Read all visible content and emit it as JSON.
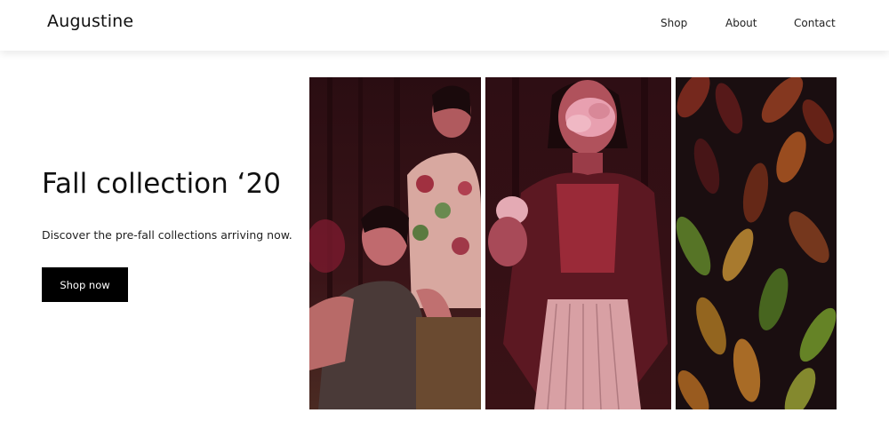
{
  "header": {
    "brand": "Augustine",
    "nav": [
      "Shop",
      "About",
      "Contact"
    ]
  },
  "hero": {
    "headline": "Fall collection ‘20",
    "subtitle": "Discover the pre-fall collections arriving now.",
    "cta_label": "Shop now"
  },
  "gallery": {
    "photos": [
      "two-women-portrait-photo",
      "woman-with-flower-photo",
      "croton-plants-photo"
    ]
  },
  "colors": {
    "accent": "#000000",
    "background": "#ffffff",
    "text": "#111111"
  }
}
